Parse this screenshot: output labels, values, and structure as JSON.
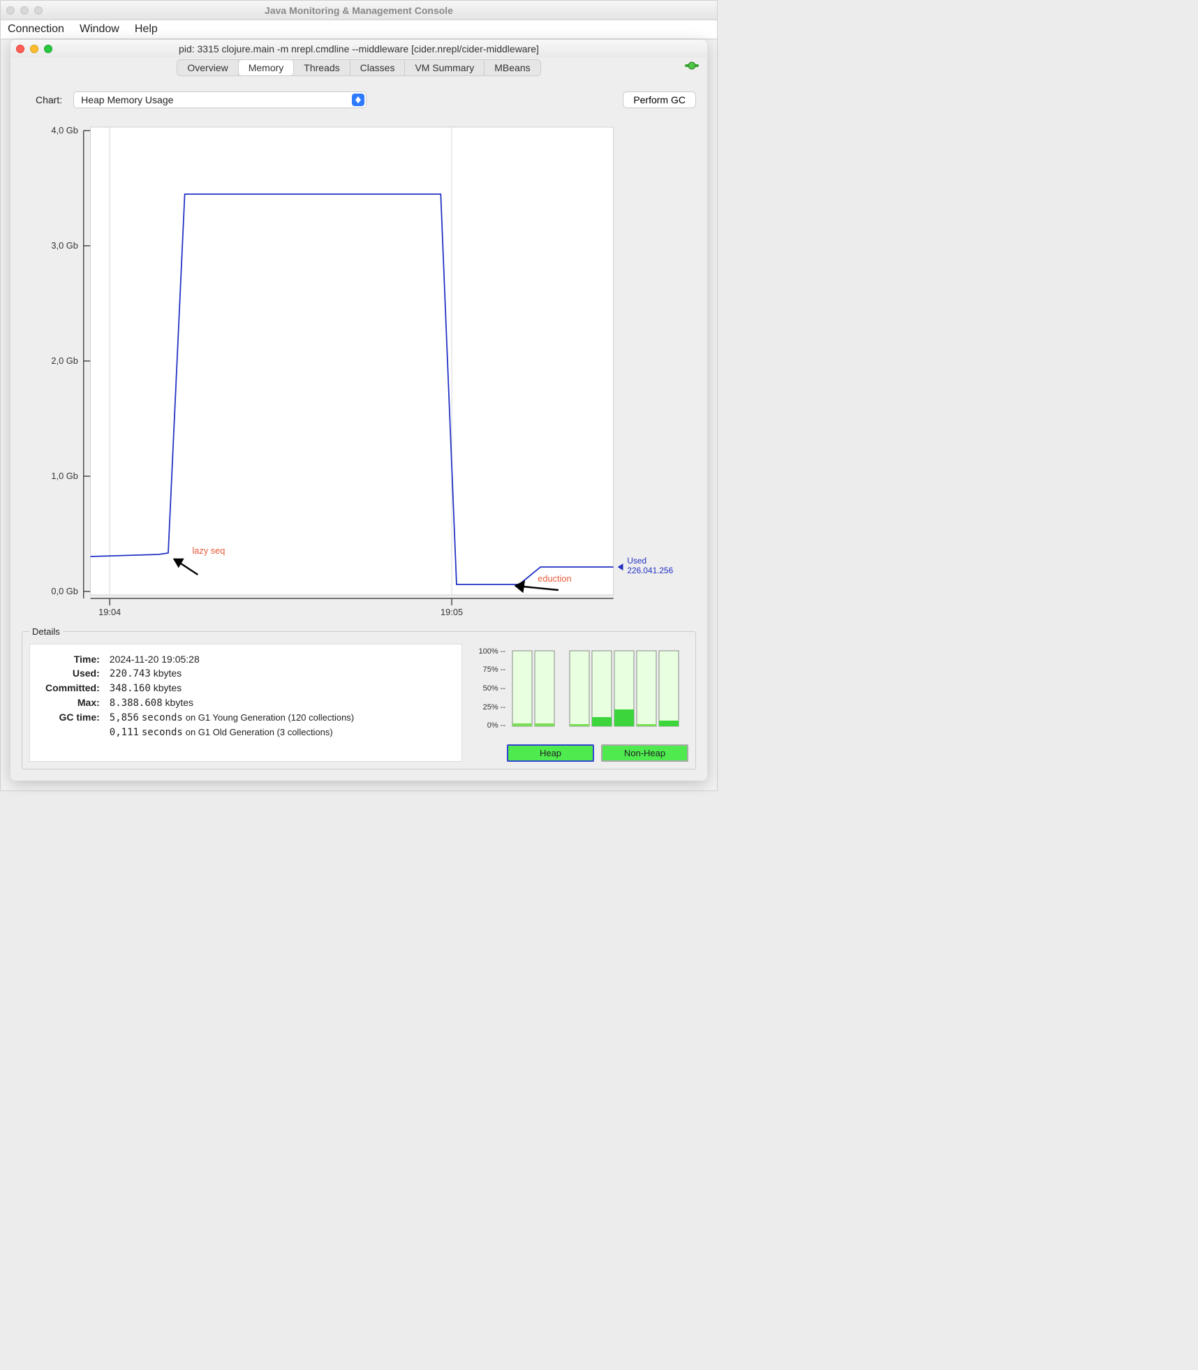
{
  "outer_window": {
    "title": "Java Monitoring & Management Console"
  },
  "outer_menu": {
    "connection": "Connection",
    "window": "Window",
    "help": "Help"
  },
  "inner_window": {
    "title": "pid: 3315 clojure.main -m nrepl.cmdline --middleware [cider.nrepl/cider-middleware]"
  },
  "tabs": {
    "overview": "Overview",
    "memory": "Memory",
    "threads": "Threads",
    "classes": "Classes",
    "vm_summary": "VM Summary",
    "mbeans": "MBeans"
  },
  "chart_selector": {
    "label": "Chart:",
    "value": "Heap Memory Usage"
  },
  "gc_button": "Perform GC",
  "used_label": "Used",
  "used_value": "226.041.256",
  "annotations": {
    "lazy_seq": "lazy seq",
    "eduction": "eduction"
  },
  "details": {
    "legend": "Details",
    "rows": {
      "time_k": "Time:",
      "time_v": "2024-11-20 19:05:28",
      "used_k": "Used:",
      "used_v": "220.743",
      "used_u": "kbytes",
      "committed_k": "Committed:",
      "committed_v": "348.160",
      "committed_u": "kbytes",
      "max_k": "Max:",
      "max_v": "8.388.608",
      "max_u": "kbytes",
      "gc_k": "GC time:",
      "gc1_v": "5,856",
      "gc1_u": "seconds",
      "gc1_note": "on G1 Young Generation (120 collections)",
      "gc2_v": "0,111",
      "gc2_u": "seconds",
      "gc2_note": "on G1 Old Generation (3 collections)"
    }
  },
  "bars": {
    "yticks": [
      "100% --",
      "75% --",
      "50% --",
      "25% --",
      "0% --"
    ],
    "heap_btn": "Heap",
    "nonheap_btn": "Non-Heap"
  },
  "chart_data": {
    "type": "line",
    "title": "Heap Memory Usage",
    "ylabel": "Gb",
    "ylim": [
      0,
      4.0
    ],
    "yticks": [
      0.0,
      1.0,
      2.0,
      3.0,
      4.0
    ],
    "ytick_labels": [
      "0,0 Gb",
      "1,0 Gb",
      "2,0 Gb",
      "3,0 Gb",
      "4,0 Gb"
    ],
    "xticks": [
      "19:04",
      "19:05"
    ],
    "series": [
      {
        "name": "Used",
        "points": [
          {
            "t": 0.0,
            "gb": 0.3
          },
          {
            "t": 0.13,
            "gb": 0.32
          },
          {
            "t": 0.15,
            "gb": 0.33
          },
          {
            "t": 0.18,
            "gb": 3.45
          },
          {
            "t": 0.67,
            "gb": 3.45
          },
          {
            "t": 0.7,
            "gb": 0.06
          },
          {
            "t": 0.82,
            "gb": 0.06
          },
          {
            "t": 0.86,
            "gb": 0.21
          },
          {
            "t": 1.0,
            "gb": 0.21
          }
        ]
      }
    ],
    "bar_charts": {
      "heap": {
        "bars": [
          {
            "fill_pct": 3
          },
          {
            "fill_pct": 3
          }
        ]
      },
      "nonheap": {
        "bars": [
          {
            "fill_pct": 2
          },
          {
            "fill_pct": 12
          },
          {
            "fill_pct": 22
          },
          {
            "fill_pct": 2
          },
          {
            "fill_pct": 7
          }
        ]
      }
    }
  }
}
